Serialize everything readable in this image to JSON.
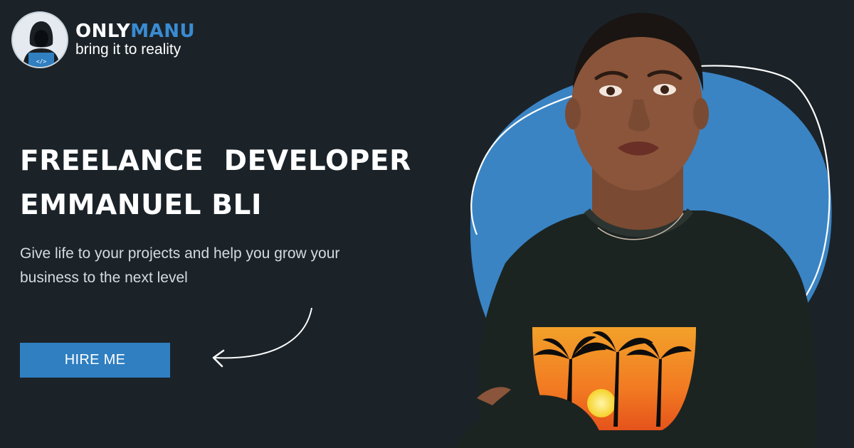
{
  "brand": {
    "name_part1": "ONLY",
    "name_part2": "MANU",
    "tagline": "bring it to reality",
    "accent_color": "#3a8bd1",
    "logo_icon": "hooded-coder-laptop-icon",
    "laptop_badge": "</>"
  },
  "hero": {
    "title_line1": "FREELANCE  DEVELOPER",
    "title_line2": "EMMANUEL BLI",
    "subtitle": "Give life to your projects and help you grow your business to the next level",
    "cta_label": "HIRE ME",
    "cta_color": "#2f7fc1",
    "background_color": "#1b2329",
    "portrait": "illustrated-developer-portrait",
    "decoration": "curved-arrow-icon"
  }
}
